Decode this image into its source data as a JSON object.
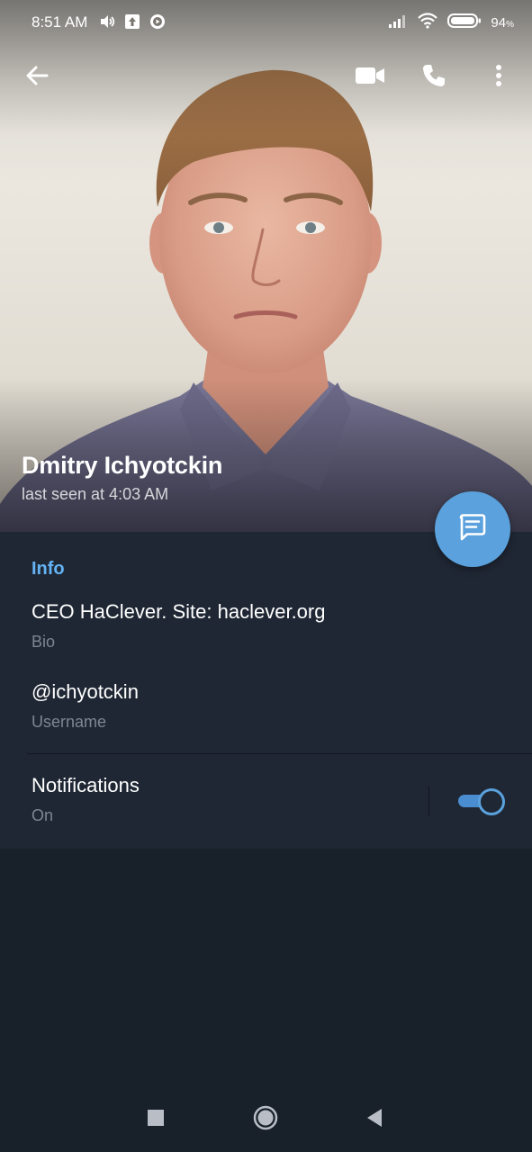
{
  "status_bar": {
    "time": "8:51 AM",
    "battery": "94",
    "battery_unit": "%",
    "icons": [
      "volume-icon",
      "upload-icon",
      "media-icon",
      "signal-icon",
      "wifi-icon",
      "battery-icon"
    ]
  },
  "toolbar": {
    "icons": [
      "back-arrow-icon",
      "video-call-icon",
      "phone-icon",
      "more-vertical-icon"
    ]
  },
  "profile": {
    "name": "Dmitry Ichyotckin",
    "last_seen": "last seen at 4:03 AM"
  },
  "fab": {
    "icon": "message-icon"
  },
  "info": {
    "section_title": "Info",
    "bio": {
      "value": "CEO HaClever. Site: haclever.org",
      "label": "Bio"
    },
    "username": {
      "value": "@ichyotckin",
      "label": "Username"
    }
  },
  "notifications": {
    "title": "Notifications",
    "state": "On",
    "enabled": true
  },
  "nav_bar": {
    "icons": [
      "recents-square-icon",
      "home-circle-icon",
      "back-triangle-icon"
    ]
  },
  "colors": {
    "accent": "#5aa1dd",
    "section_title": "#64b3f4",
    "panel_bg": "#1f2734",
    "page_bg": "#18202a"
  }
}
